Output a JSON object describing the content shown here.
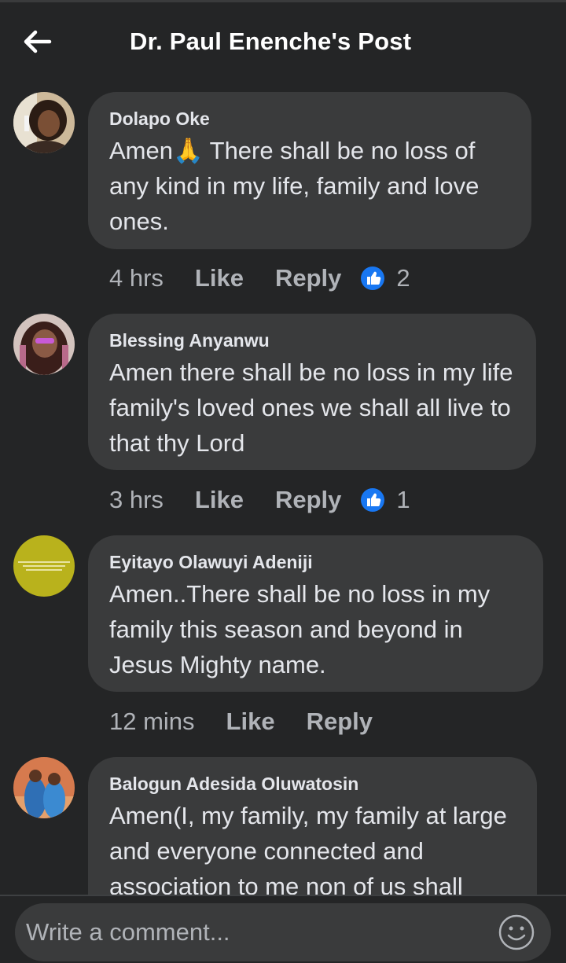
{
  "header": {
    "title": "Dr. Paul Enenche's Post",
    "back_icon": "arrow-left-icon"
  },
  "colors": {
    "background": "#242526",
    "bubble": "#3a3b3c",
    "text": "#e4e6eb",
    "secondary_text": "#b0b3b8",
    "like_badge": "#1877f2"
  },
  "comments": [
    {
      "author": "Dolapo Oke",
      "text": "Amen🙏 There shall be no loss of any kind in my life, family and love ones.",
      "time": "4 hrs",
      "like_label": "Like",
      "reply_label": "Reply",
      "reaction_icon": "thumbs-up-icon",
      "reaction_count": "2"
    },
    {
      "author": "Blessing Anyanwu",
      "text": "Amen there shall be no loss in my life family's loved ones we shall all live to that thy Lord",
      "time": "3 hrs",
      "like_label": "Like",
      "reply_label": "Reply",
      "reaction_icon": "thumbs-up-icon",
      "reaction_count": "1"
    },
    {
      "author": "Eyitayo Olawuyi Adeniji",
      "text": "Amen..There shall be no loss in my family this season and beyond in Jesus Mighty name.",
      "time": "12 mins",
      "like_label": "Like",
      "reply_label": "Reply"
    },
    {
      "author": "Balogun Adesida Oluwatosin",
      "text": "Amen(I, my family, my family at large and everyone connected and association to me non of us shall"
    }
  ],
  "composer": {
    "placeholder": "Write a comment...",
    "emoji_icon": "smiley-icon"
  }
}
